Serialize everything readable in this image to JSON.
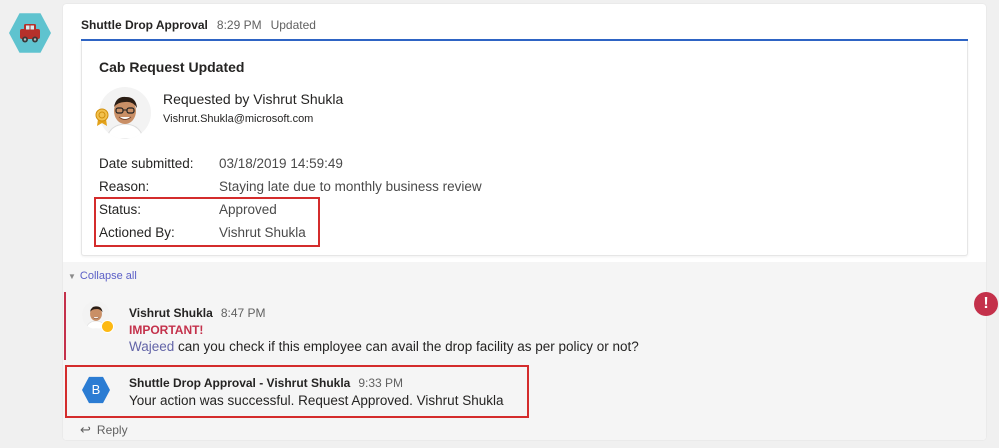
{
  "post": {
    "sender": "Shuttle Drop Approval",
    "time": "8:29 PM",
    "status_tag": "Updated"
  },
  "card": {
    "title": "Cab Request Updated",
    "requested_by": "Requested by Vishrut Shukla",
    "email": "Vishrut.Shukla@microsoft.com",
    "facts": [
      {
        "label": "Date submitted:",
        "value": "03/18/2019 14:59:49"
      },
      {
        "label": "Reason:",
        "value": "Staying late due to monthly business review"
      },
      {
        "label": "Status:",
        "value": "Approved"
      },
      {
        "label": "Actioned By:",
        "value": "Vishrut Shukla"
      }
    ]
  },
  "thread": {
    "collapse_label": "Collapse all",
    "replies": [
      {
        "name": "Vishrut Shukla",
        "time": "8:47 PM",
        "importance": "IMPORTANT!",
        "mention": "Wajeed",
        "text": " can you check if this employee can avail the drop facility as per policy or not?"
      },
      {
        "avatar_letter": "B",
        "name": "Shuttle Drop Approval - Vishrut Shukla",
        "time": "9:33 PM",
        "text": "Your action was successful. Request Approved. Vishrut Shukla"
      }
    ],
    "reply_label": "Reply"
  },
  "colors": {
    "accent_blue": "#2e64c4",
    "important_red": "#c4314b",
    "highlight_red": "#d42c2c",
    "bot_teal": "#5fc3cf",
    "bot_blue": "#2b7cd3"
  },
  "icons": [
    "car-icon",
    "chevron-down-icon",
    "reply-arrow-icon",
    "alert-icon",
    "award-badge-icon"
  ]
}
